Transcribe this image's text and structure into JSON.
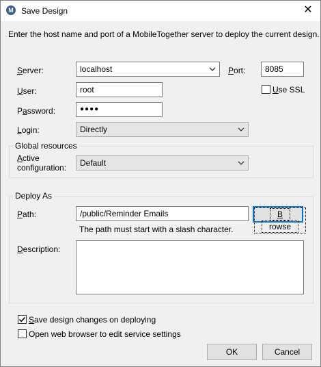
{
  "window": {
    "title": "Save Design",
    "icon": "mobiletogether-app-icon",
    "close_glyph": "✕"
  },
  "intro_text": "Enter the host name and port of a MobileTogether server to deploy the current design.",
  "server": {
    "server_label_key": "S",
    "server_label_rest": "erver:",
    "server_value": "localhost",
    "port_label_key": "P",
    "port_label_rest": "ort:",
    "port_value": "8085",
    "user_label_key": "U",
    "user_label_rest": "ser:",
    "user_value": "root",
    "use_ssl_label_key": "U",
    "use_ssl_label_rest": "se SSL",
    "use_ssl_checked": false,
    "password_label_pre": "P",
    "password_label_key": "a",
    "password_label_rest": "ssword:",
    "password_masked": "●●●●",
    "login_label_key": "L",
    "login_label_rest": "ogin:",
    "login_value": "Directly"
  },
  "global_resources": {
    "legend": "Global resources",
    "active_label_key": "A",
    "active_label_rest": "ctive",
    "configuration_label": "configuration:",
    "active_value": "Default"
  },
  "deploy_as": {
    "legend": "Deploy As",
    "path_label_key": "P",
    "path_label_rest": "ath:",
    "path_value": "/public/Reminder Emails",
    "browse_key": "B",
    "browse_rest": "rowse",
    "hint": "The path must start with a slash character.",
    "description_label_key": "D",
    "description_label_rest": "escription:",
    "description_value": ""
  },
  "options": {
    "save_changes_key": "S",
    "save_changes_rest": "ave design changes on deploying",
    "save_changes_checked": true,
    "open_browser_label": "Open web browser to edit service settings",
    "open_browser_checked": false
  },
  "buttons": {
    "ok": "OK",
    "cancel": "Cancel"
  },
  "colors": {
    "default_button_border": "#0078d7",
    "dialog_bg": "#f0f0f0"
  }
}
